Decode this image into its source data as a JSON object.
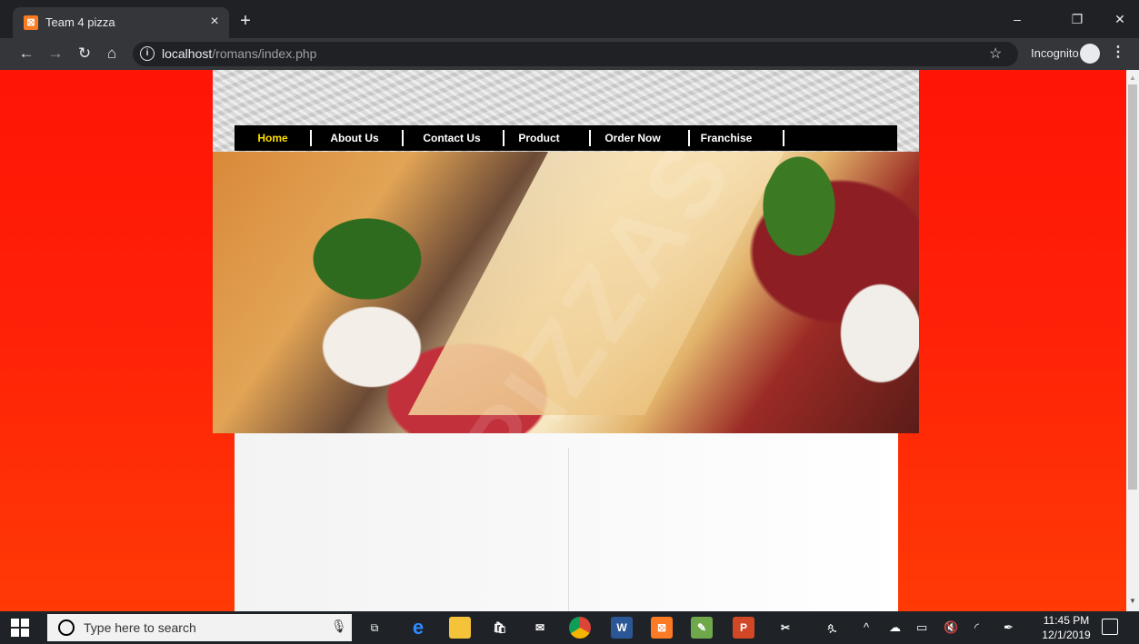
{
  "browser": {
    "tab_title": "Team 4 pizza",
    "tab_close": "×",
    "new_tab": "+",
    "url_host": "localhost",
    "url_path": "/romans/index.php",
    "incognito_label": "Incognito",
    "win_minimize": "–",
    "win_restore": "❐",
    "win_close": "✕"
  },
  "site": {
    "nav": [
      {
        "label": "Home",
        "active": true
      },
      {
        "label": "About Us"
      },
      {
        "label": "Contact Us"
      },
      {
        "label": "Product"
      },
      {
        "label": "Order Now"
      },
      {
        "label": "Franchise"
      }
    ],
    "hero_watermark": "PIZZAS"
  },
  "taskbar": {
    "search_placeholder": "Type here to search",
    "apps": [
      "task-view",
      "edge",
      "file-explorer",
      "store",
      "mail",
      "chrome",
      "word",
      "xampp",
      "notepad",
      "powerpoint",
      "snipping-tool"
    ],
    "time": "11:45 PM",
    "date": "12/1/2019"
  },
  "colors": {
    "page_bg_top": "#ff1406",
    "page_bg_bottom": "#ff3a05",
    "nav_bg": "#000000",
    "nav_active": "#ffde00"
  }
}
